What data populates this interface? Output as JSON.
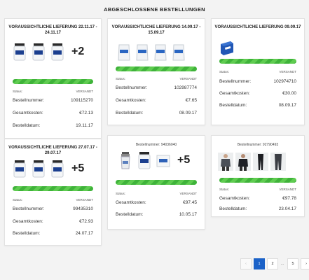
{
  "page": {
    "title": "ABGESCHLOSSENE BESTELLUNGEN"
  },
  "orders": [
    {
      "heading": "VORAUSSICHTLICHE LIEFERUNG 22.11.17 - 24.11.17",
      "heading_line1": "VORAUSSICHTLICHE LIEFERUNG 22.11.17 -",
      "heading_line2": "24.11.17",
      "thumbs": [
        "supplement-jar-icon",
        "supplement-jar-icon",
        "supplement-jar-icon"
      ],
      "more_count": "+2",
      "progress": 1.0,
      "status_label": "Status:",
      "status_value": "VERSANDT",
      "order_number_label": "Bestellnummer:",
      "order_number": "109115270",
      "total_label": "Gesamtkosten:",
      "total": "€72.13",
      "date_label": "Bestelldatum:",
      "date": "19.11.17"
    },
    {
      "heading": "VORAUSSICHTLICHE LIEFERUNG 14.09.17 - 15.09.17",
      "heading_line1": "VORAUSSICHTLICHE LIEFERUNG 14.09.17 -",
      "heading_line2": "15.09.17",
      "thumbs": [
        "supplement-pouch-icon",
        "supplement-pouch-icon",
        "supplement-pouch-icon",
        "supplement-pouch-icon"
      ],
      "progress": 1.0,
      "status_label": "Status:",
      "status_value": "VERSANDT",
      "order_number_label": "Bestellnummer:",
      "order_number": "102987774",
      "total_label": "Gesamtkosten:",
      "total": "€7.65",
      "date_label": "Bestelldatum:",
      "date": "08.09.17"
    },
    {
      "heading": "VORAUSSICHTLICHE LIEFERUNG 09.09.17",
      "thumbs": [
        "product-box-icon"
      ],
      "progress": 1.0,
      "status_label": "Status:",
      "status_value": "VERSANDT",
      "order_number_label": "Bestellnummer:",
      "order_number": "102974710",
      "total_label": "Gesamtkosten:",
      "total": "€30.00",
      "date_label": "Bestelldatum:",
      "date": "08.09.17"
    },
    {
      "heading_line1": "VORAUSSICHTLICHE LIEFERUNG 27.07.17 -",
      "heading_line2": "29.07.17",
      "thumbs": [
        "supplement-jar-icon",
        "supplement-jar-icon",
        "supplement-jar-icon"
      ],
      "more_count": "+5",
      "progress": 1.0,
      "status_label": "Status:",
      "status_value": "VERSANDT",
      "order_number_label": "Bestellnummer:",
      "order_number": "99435310",
      "total_label": "Gesamtkosten:",
      "total": "€72.93",
      "date_label": "Bestelldatum:",
      "date": "24.07.17"
    },
    {
      "heading": "Bestellnummer: 94036040",
      "thumbs": [
        "shaker-bottle-icon",
        "supplement-jar-icon",
        "supplement-box-icon"
      ],
      "more_count": "+5",
      "progress": 1.0,
      "status_label": "Status:",
      "status_value": "VERSANDT",
      "total_label": "Gesamtkosten:",
      "total": "€97.45",
      "date_label": "Bestelldatum:",
      "date": "10.05.17"
    },
    {
      "heading": "Bestellnummer: 92790493",
      "thumbs": [
        "jacket-icon",
        "hoodie-icon",
        "leggings-icon",
        "pants-icon"
      ],
      "progress": 1.0,
      "status_label": "Status:",
      "status_value": "VERSANDT",
      "total_label": "Gesamtkosten:",
      "total": "€97.78",
      "date_label": "Bestelldatum:",
      "date": "23.04.17"
    }
  ],
  "pagination": {
    "prev": "‹",
    "pages": [
      "1",
      "2",
      "5"
    ],
    "dots": "…",
    "current": "1",
    "next": "›"
  },
  "colors": {
    "progress": "#3fb33a",
    "active_page": "#1b62c8"
  }
}
